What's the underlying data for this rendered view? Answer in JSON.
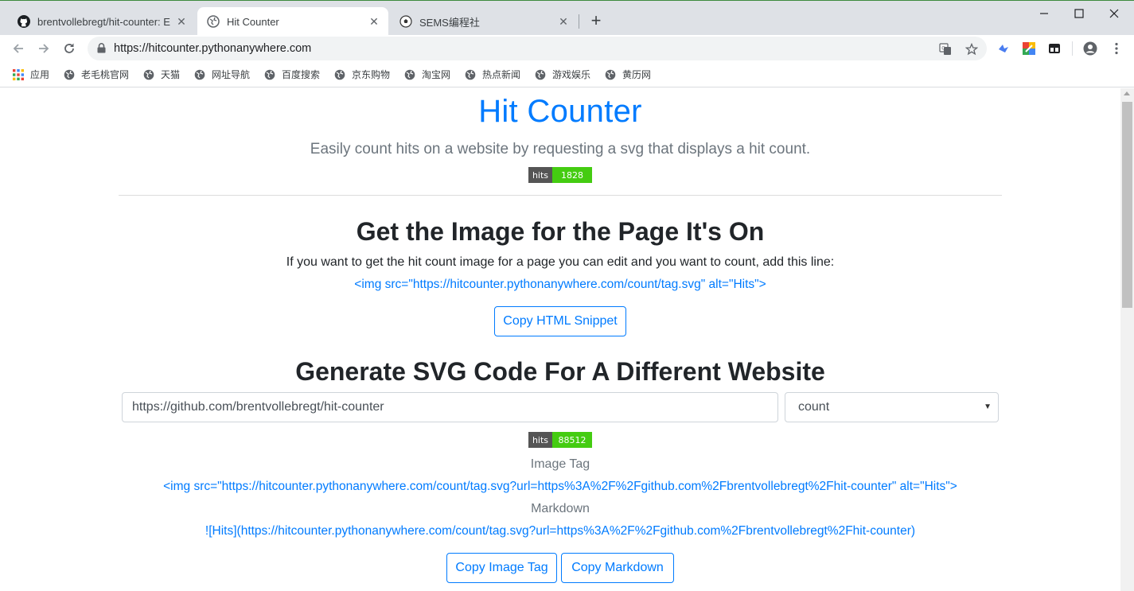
{
  "browser": {
    "tabs": [
      {
        "title": "brentvollebregt/hit-counter: E",
        "icon": "github-icon",
        "active": false
      },
      {
        "title": "Hit Counter",
        "icon": "globe-icon",
        "active": true
      },
      {
        "title": "SEMS编程社",
        "icon": "soccer-icon",
        "active": false
      }
    ],
    "new_tab_label": "+",
    "url": "https://hitcounter.pythonanywhere.com"
  },
  "bookmarks": [
    {
      "label": "应用",
      "icon": "apps-grid-icon"
    },
    {
      "label": "老毛桃官网",
      "icon": "globe-icon"
    },
    {
      "label": "天猫",
      "icon": "globe-icon"
    },
    {
      "label": "网址导航",
      "icon": "globe-icon"
    },
    {
      "label": "百度搜索",
      "icon": "globe-icon"
    },
    {
      "label": "京东购物",
      "icon": "globe-icon"
    },
    {
      "label": "淘宝网",
      "icon": "globe-icon"
    },
    {
      "label": "热点新闻",
      "icon": "globe-icon"
    },
    {
      "label": "游戏娱乐",
      "icon": "globe-icon"
    },
    {
      "label": "黄历网",
      "icon": "globe-icon"
    }
  ],
  "page": {
    "title": "Hit Counter",
    "lead": "Easily count hits on a website by requesting a svg that displays a hit count.",
    "top_badge": {
      "label": "hits",
      "value": "1828"
    },
    "section1": {
      "heading": "Get the Image for the Page It's On",
      "description": "If you want to get the hit count image for a page you can edit and you want to count, add this line:",
      "code": "<img src=\"https://hitcounter.pythonanywhere.com/count/tag.svg\" alt=\"Hits\">",
      "copy_button": "Copy HTML Snippet"
    },
    "section2": {
      "heading": "Generate SVG Code For A Different Website",
      "url_input_value": "https://github.com/brentvollebregt/hit-counter",
      "select_value": "count",
      "badge": {
        "label": "hits",
        "value": "88512"
      },
      "image_tag_label": "Image Tag",
      "image_tag_code": "<img src=\"https://hitcounter.pythonanywhere.com/count/tag.svg?url=https%3A%2F%2Fgithub.com%2Fbrentvollebregt%2Fhit-counter\" alt=\"Hits\">",
      "markdown_label": "Markdown",
      "markdown_code": "![Hits](https://hitcounter.pythonanywhere.com/count/tag.svg?url=https%3A%2F%2Fgithub.com%2Fbrentvollebregt%2Fhit-counter)",
      "copy_image_tag_button": "Copy Image Tag",
      "copy_markdown_button": "Copy Markdown"
    }
  },
  "colors": {
    "link": "#007bff",
    "badge_label": "#555555",
    "badge_value": "#44cc11",
    "muted": "#6c757d"
  }
}
